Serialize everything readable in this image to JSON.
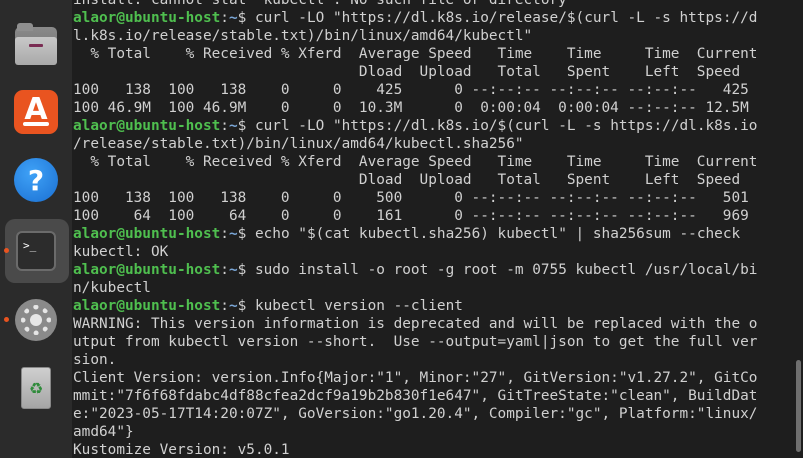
{
  "dock": {
    "items": [
      {
        "name": "files",
        "icon": "files-icon",
        "running": false
      },
      {
        "name": "app-center",
        "icon": "app-store-icon",
        "glyph": "A",
        "running": false
      },
      {
        "name": "help",
        "icon": "help-icon",
        "glyph": "?",
        "running": false
      },
      {
        "name": "terminal",
        "icon": "terminal-icon",
        "glyph": ">_",
        "running": true,
        "active": true
      },
      {
        "name": "settings",
        "icon": "gear-icon",
        "running": true
      },
      {
        "name": "trash",
        "icon": "trash-icon",
        "glyph": "♻",
        "running": false
      }
    ],
    "accent_color": "#e95420"
  },
  "terminal": {
    "prompt": {
      "user_host": "alaor@ubuntu-host",
      "sep": ":",
      "path": "~",
      "sym": "$ "
    },
    "lines": [
      {
        "type": "text",
        "text": "install: cannot stat 'kubectl': No such file or directory"
      },
      {
        "type": "cmd",
        "text": "curl -LO \"https://dl.k8s.io/release/$(curl -L -s https://d"
      },
      {
        "type": "text",
        "text": "l.k8s.io/release/stable.txt)/bin/linux/amd64/kubectl\""
      },
      {
        "type": "text",
        "text": "  % Total    % Received % Xferd  Average Speed   Time    Time     Time  Current"
      },
      {
        "type": "text",
        "text": "                                 Dload  Upload   Total   Spent    Left  Speed"
      },
      {
        "type": "text",
        "text": "100   138  100   138    0     0    425      0 --:--:-- --:--:-- --:--:--   425"
      },
      {
        "type": "text",
        "text": "100 46.9M  100 46.9M    0     0  10.3M      0  0:00:04  0:00:04 --:--:-- 12.5M"
      },
      {
        "type": "cmd",
        "text": "curl -LO \"https://dl.k8s.io/$(curl -L -s https://dl.k8s.io"
      },
      {
        "type": "text",
        "text": "/release/stable.txt)/bin/linux/amd64/kubectl.sha256\""
      },
      {
        "type": "text",
        "text": "  % Total    % Received % Xferd  Average Speed   Time    Time     Time  Current"
      },
      {
        "type": "text",
        "text": "                                 Dload  Upload   Total   Spent    Left  Speed"
      },
      {
        "type": "text",
        "text": "100   138  100   138    0     0    500      0 --:--:-- --:--:-- --:--:--   501"
      },
      {
        "type": "text",
        "text": "100    64  100    64    0     0    161      0 --:--:-- --:--:-- --:--:--   969"
      },
      {
        "type": "cmd",
        "text": "echo \"$(cat kubectl.sha256) kubectl\" | sha256sum --check"
      },
      {
        "type": "text",
        "text": "kubectl: OK"
      },
      {
        "type": "cmd",
        "text": "sudo install -o root -g root -m 0755 kubectl /usr/local/bi"
      },
      {
        "type": "text",
        "text": "n/kubectl"
      },
      {
        "type": "cmd",
        "text": "kubectl version --client"
      },
      {
        "type": "text",
        "text": "WARNING: This version information is deprecated and will be replaced with the o"
      },
      {
        "type": "text",
        "text": "utput from kubectl version --short.  Use --output=yaml|json to get the full ver"
      },
      {
        "type": "text",
        "text": "sion."
      },
      {
        "type": "text",
        "text": "Client Version: version.Info{Major:\"1\", Minor:\"27\", GitVersion:\"v1.27.2\", GitCo"
      },
      {
        "type": "text",
        "text": "mmit:\"7f6f68fdabc4df88cfea2dcf9a19b2b830f1e647\", GitTreeState:\"clean\", BuildDat"
      },
      {
        "type": "text",
        "text": "e:\"2023-05-17T14:20:07Z\", GoVersion:\"go1.20.4\", Compiler:\"gc\", Platform:\"linux/"
      },
      {
        "type": "text",
        "text": "amd64\"}"
      },
      {
        "type": "text",
        "text": "Kustomize Version: v5.0.1"
      }
    ]
  }
}
